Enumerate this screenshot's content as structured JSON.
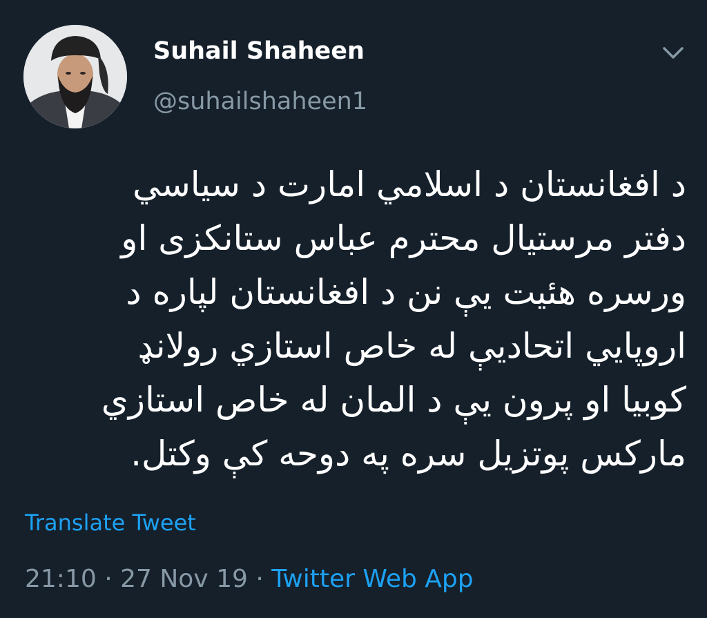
{
  "user": {
    "display_name": "Suhail Shaheen",
    "handle": "@suhailshaheen1",
    "avatar_icon": "profile-photo"
  },
  "menu": {
    "icon": "chevron-down-icon"
  },
  "tweet": {
    "lines": [
      "د افغانستان د اسلامي امارت د سیاسي",
      "دفتر مرستیال محترم عباس ستانکزی او",
      "ورسره هئیت یې نن د افغانستان لپاره د",
      "اروپایي اتحادیې له خاص استازي رولانډ",
      "کوبیا  او پرون یې د المان له خاص استازي",
      "مارکس پوتزیل سره په دوحه کې وکتل."
    ],
    "translate_label": "Translate Tweet"
  },
  "meta": {
    "time": "21:10",
    "separator": "·",
    "date": "27 Nov 19",
    "source": "Twitter Web App"
  },
  "colors": {
    "background": "#15202b",
    "primary_text": "#ffffff",
    "secondary_text": "#8899a6",
    "accent": "#1da1f2"
  }
}
